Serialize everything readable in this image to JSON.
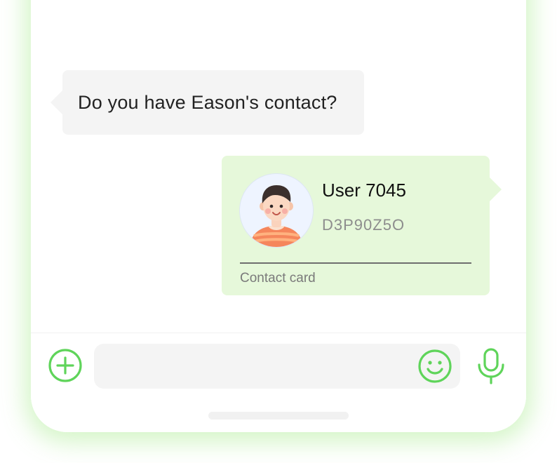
{
  "chat": {
    "incoming": {
      "text": "Do you have Eason's contact?"
    },
    "contact_card": {
      "name": "User 7045",
      "id": "D3P90Z5O",
      "label": "Contact card",
      "avatar_icon": "boy-avatar-icon"
    }
  },
  "composer": {
    "value": "",
    "placeholder": "",
    "plus_icon": "plus-circle-icon",
    "emoji_icon": "smiley-icon",
    "mic_icon": "microphone-icon"
  },
  "colors": {
    "accent": "#5fd45a",
    "incoming_bubble": "#f4f4f4",
    "outgoing_bubble": "#e6f8da",
    "glow": "#96e878"
  }
}
